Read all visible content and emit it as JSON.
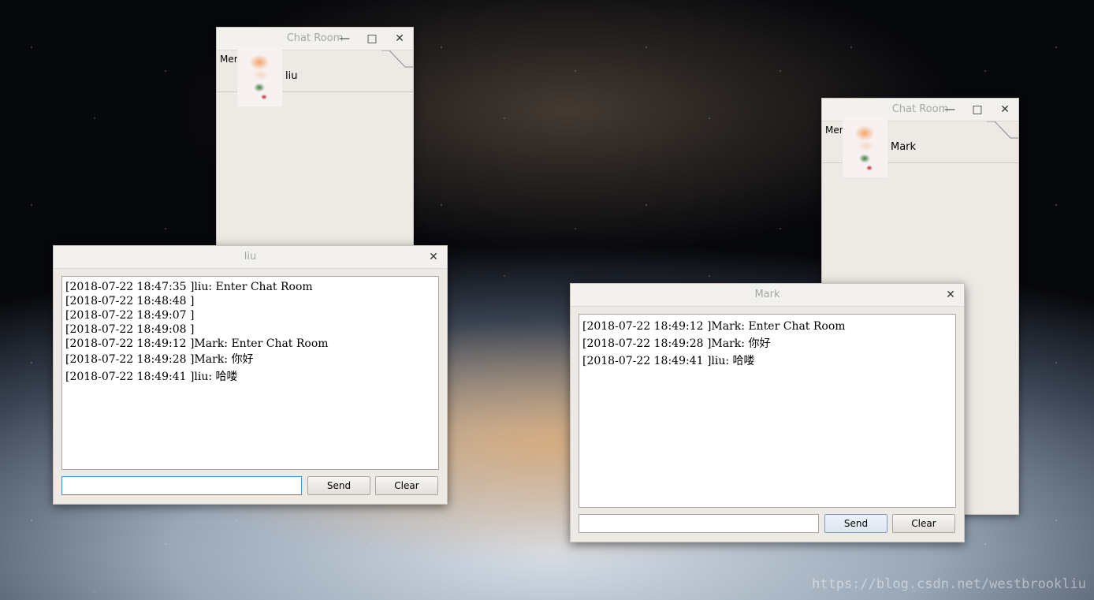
{
  "desktop": {
    "watermark": "https://blog.csdn.net/westbrookliu"
  },
  "member_windows": [
    {
      "title": "Chat Room",
      "tab_label": "Member",
      "member_name": "liu"
    },
    {
      "title": "Chat Room",
      "tab_label": "Member",
      "member_name": "Mark"
    }
  ],
  "chat_windows": [
    {
      "title": "liu",
      "messages": [
        "[2018-07-22 18:47:35 ]liu: Enter Chat Room",
        "[2018-07-22 18:48:48 ]",
        "[2018-07-22 18:49:07 ]",
        "[2018-07-22 18:49:08 ]",
        "[2018-07-22 18:49:12 ]Mark: Enter Chat Room",
        "[2018-07-22 18:49:28 ]Mark: 你好",
        "[2018-07-22 18:49:41 ]liu: 哈喽"
      ],
      "input_value": "",
      "send_label": "Send",
      "clear_label": "Clear"
    },
    {
      "title": "Mark",
      "messages": [
        "[2018-07-22 18:49:12 ]Mark: Enter Chat Room",
        "[2018-07-22 18:49:28 ]Mark: 你好",
        "[2018-07-22 18:49:41 ]liu: 哈喽"
      ],
      "input_value": "",
      "send_label": "Send",
      "clear_label": "Clear"
    }
  ],
  "icons": {
    "minimize": "minimize-icon",
    "maximize": "maximize-icon",
    "close": "close-icon"
  }
}
